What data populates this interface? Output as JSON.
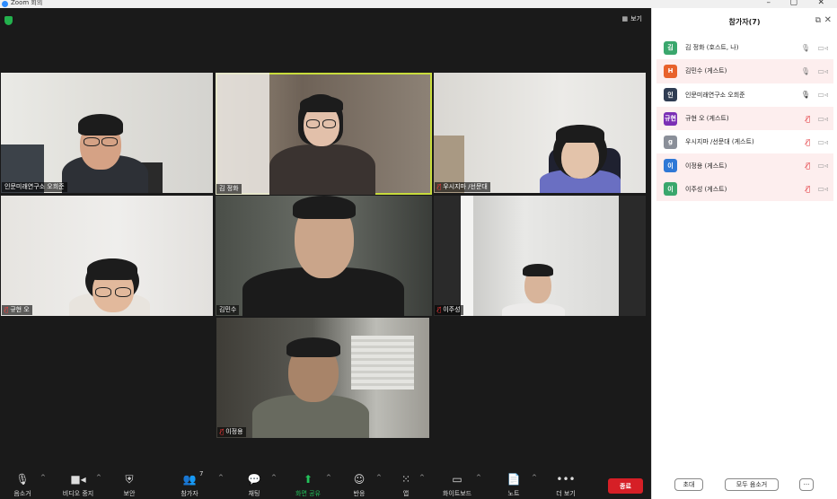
{
  "window": {
    "title": "Zoom 회의",
    "minimize": "–",
    "maximize": "▢",
    "close": "✕"
  },
  "stage": {
    "view_label": "보기"
  },
  "tiles": [
    {
      "name": "인문미래연구소 오희준",
      "muted": false
    },
    {
      "name": "김 정화",
      "muted": false,
      "active": true
    },
    {
      "name": "우시지마 /선문대",
      "muted": true
    },
    {
      "name": "규현 오",
      "muted": true
    },
    {
      "name": "김민수",
      "muted": false
    },
    {
      "name": "이주성",
      "muted": true
    },
    {
      "name": "이정용",
      "muted": true
    }
  ],
  "sidebar": {
    "title": "참가자(7)",
    "participants": [
      {
        "avatar": "김",
        "color": "#3aa76d",
        "name": "김 정화 (호스트, 나)",
        "mic": "on"
      },
      {
        "avatar": "H",
        "color": "#e8622c",
        "name": "김민수 (게스트)",
        "mic": "on"
      },
      {
        "avatar": "인",
        "color": "#2f3c52",
        "name": "인문미래연구소 오희준",
        "mic": "on"
      },
      {
        "avatar": "규현",
        "color": "#7b2fb5",
        "name": "규현 오 (게스트)",
        "mic": "off"
      },
      {
        "avatar": "g",
        "color": "#8a8f99",
        "name": "우시지마 /선문대 (게스트)",
        "mic": "off"
      },
      {
        "avatar": "이",
        "color": "#2f78d6",
        "name": "이정용 (게스트)",
        "mic": "off"
      },
      {
        "avatar": "이",
        "color": "#3aa76d",
        "name": "이주성 (게스트)",
        "mic": "off"
      }
    ],
    "invite_label": "초대",
    "mute_all_label": "모두 음소거",
    "more_label": "···"
  },
  "toolbar": {
    "mute": "음소거",
    "video": "비디오 중지",
    "security": "보안",
    "participants": "참가자",
    "participants_count": "7",
    "chat": "채팅",
    "share": "화면 공유",
    "reactions": "반응",
    "apps": "앱",
    "whiteboard": "화이트보드",
    "notes": "노트",
    "more": "더 보기",
    "end": "종료"
  }
}
